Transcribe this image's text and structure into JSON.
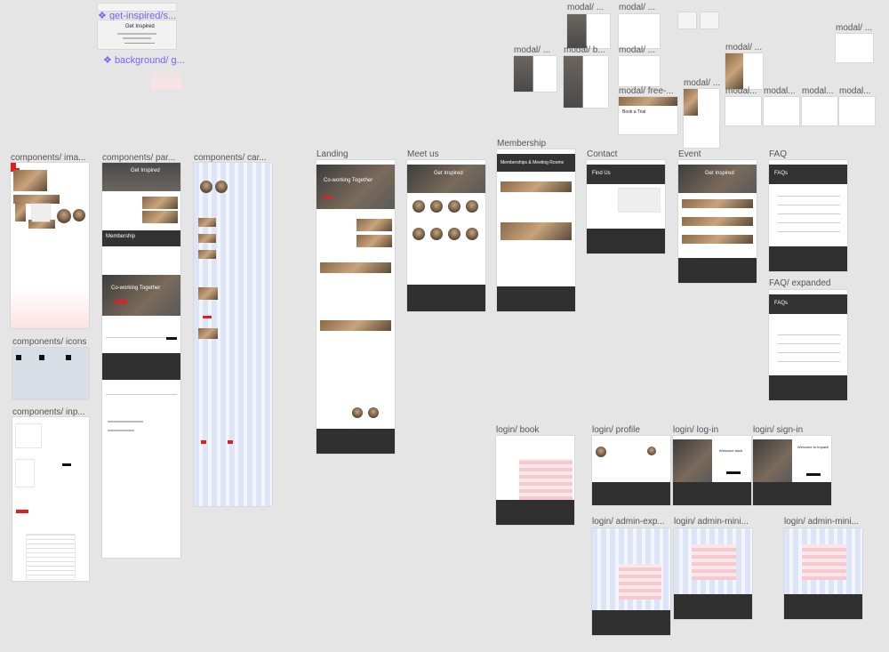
{
  "canvas": {
    "labels": {
      "get_inspired": "get-inspired/s...",
      "background": "background/ g...",
      "components_images": "components/ ima...",
      "components_parts": "components/ par...",
      "components_cards": "components/ car...",
      "components_icons": "components/ icons",
      "components_inputs": "components/ inp...",
      "landing": "Landing",
      "meet_us": "Meet us",
      "membership": "Membership",
      "contact": "Contact",
      "event": "Event",
      "faq": "FAQ",
      "faq_expanded": "FAQ/ expanded",
      "login_book": "login/ book",
      "login_profile": "login/ profile",
      "login_log_in": "login/ log-in",
      "login_sign_in": "login/ sign-in",
      "login_admin_exp": "login/ admin-exp...",
      "login_admin_mini_1": "login/ admin-mini...",
      "login_admin_mini_2": "login/ admin-mini...",
      "modal_1": "modal/ ...",
      "modal_2": "modal/ ...",
      "modal_3": "modal/ ...",
      "modal_4": "modal/ ...",
      "modal_b": "modal/ b...",
      "modal_5": "modal/ ...",
      "modal_free": "modal/ free-...",
      "modal_6": "modal/ ...",
      "modal_7": "modal/ ...",
      "modal_8": "modal...",
      "modal_9": "modal...",
      "modal_10": "modal...",
      "modal_11": "modal..."
    },
    "component_symbol": "❖",
    "frame_titles": {
      "get_inspired": "Get Inspired",
      "hero_landing": "Co-working Together",
      "hero_meet": "Get Inspired",
      "hero_membership": "Memberships & Meeting Rooms",
      "hero_contact": "Find Us",
      "hero_event": "Get Inspired",
      "hero_faq": "FAQs",
      "hero_faq_exp": "FAQs",
      "parts_get_inspired": "Get Inspired",
      "parts_membership": "Membership",
      "parts_coworking": "Co-working Together",
      "login_welcome": "Welcome back",
      "login_signin": "Welcome to Impact!",
      "modal_book": "Book a Trial"
    },
    "colors": {
      "canvas": "#e5e5e5",
      "dark": "#333333",
      "accent": "#e02020",
      "component_label": "#7b61ff",
      "grid": "#dde4f5"
    }
  }
}
